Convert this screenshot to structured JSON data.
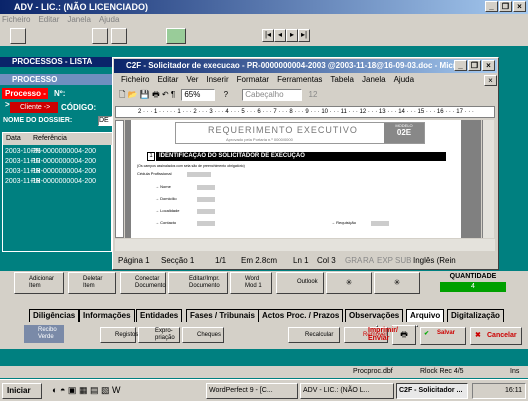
{
  "app": {
    "title": "ADV - LIC.: (NÃO LICENCIADO)",
    "menu": [
      "Ficheiro",
      "Editar",
      "Janela",
      "Ajuda"
    ]
  },
  "processos": {
    "title": "PROCESSOS - LISTA",
    "header": "PROCESSO",
    "processo_label": "Processo ->",
    "n_label": "Nº:",
    "cliente_label": "Cliente ->",
    "codigo_label": "CÓDIGO:",
    "dossier_label": "NOME DO DOSSIER:",
    "dossier_value": "DE",
    "col_data": "Data",
    "col_ref": "Referência",
    "rows": [
      [
        "2003-10-25",
        "PR-0000000004-200"
      ],
      [
        "2003-11-10",
        "PR-0000000004-200"
      ],
      [
        "2003-11-18",
        "PR-0000000004-200"
      ],
      [
        "2003-11-18",
        "PR-0000000004-200"
      ]
    ]
  },
  "word": {
    "title": "C2F - Solicitador de execucao - PR-0000000004-2003 @2003-11-18@16-09-03.doc - Micro...",
    "menu": [
      "Ficheiro",
      "Editar",
      "Ver",
      "Inserir",
      "Formatar",
      "Ferramentas",
      "Tabela",
      "Janela",
      "Ajuda"
    ],
    "zoom": "65%",
    "style": "Cabeçalho",
    "size": "12",
    "ruler": "2 · · · 1 · · · · · 1 · · · 2 · · · 3 · · · 4 · · · 5 · · · 6 · · · 7 · · · 8 · · · 9 · · · 10 · · · 11 · · · 12 · · · 13 · · · 14 · · · 15 · · · 16 · · · 17 · · ·",
    "doc_title": "REQUERIMENTO EXECUTIVO",
    "doc_sub": "Aprovado pela Portaria n.º 0000/0000",
    "doc_modelo": "MODELO",
    "doc_code": "02E",
    "section": "IDENTIFICAÇÃO DO SOLICITADOR DE EXECUÇÃO",
    "section_num": "1",
    "note": "(Os campos assinalados com seta são de preenchimento obrigatório)",
    "fields": [
      "Cédula Profissional",
      "Nome",
      "Domicílio",
      "Localidade",
      "Contacto"
    ],
    "field_requisicao": "Requisição",
    "status": {
      "pagina": "Página 1",
      "seccao": "Secção 1",
      "pages": "1/1",
      "pos": "Em 2.8cm",
      "ln": "Ln 1",
      "col": "Col 3",
      "modes": [
        "GRA",
        "RA",
        "EXP",
        "SUB"
      ],
      "lang": "Inglês (Rein"
    }
  },
  "toolbar": {
    "adicionar": "Adicionar Item",
    "deletar": "Deletar Item",
    "conectar": "Conectar Documento",
    "editar": "Editar/Impr. Documento",
    "wordmod": "Word Mod 1",
    "outlook": "Outlook",
    "quantidade_label": "QUANTIDADE",
    "quantidade_value": "4"
  },
  "tabs": [
    "Diligências",
    "Informações",
    "Entidades",
    "Fases / Tribunais",
    "Actos Proc. / Prazos",
    "Observações",
    "Arquivo",
    "Digitalização"
  ],
  "actions": {
    "recibo": "Recibo Verde",
    "registos": "Registos",
    "expropriacao": "Expro-priação",
    "cheques": "Cheques",
    "recalcular": "Recalcular",
    "remover": "Remover",
    "imprimir": "Imprimir/ Enviar",
    "salvar": "Salvar",
    "cancelar": "Cancelar"
  },
  "statusbar": {
    "file": "Procproc.dbf",
    "record": "Rlock Rec 4/5",
    "ins": "Ins"
  },
  "taskbar": {
    "start": "Iniciar",
    "tasks": [
      "WordPerfect 9 - [C...",
      "ADV - LIC.: (NÃO L...",
      "C2F - Solicitador ..."
    ],
    "clock": "16:11"
  },
  "colors": {
    "teal": "#008080",
    "titlebar": "#0a246a",
    "processo_red": "#ff0000",
    "quantidade_green": "#00a000",
    "section_black": "#000000"
  }
}
